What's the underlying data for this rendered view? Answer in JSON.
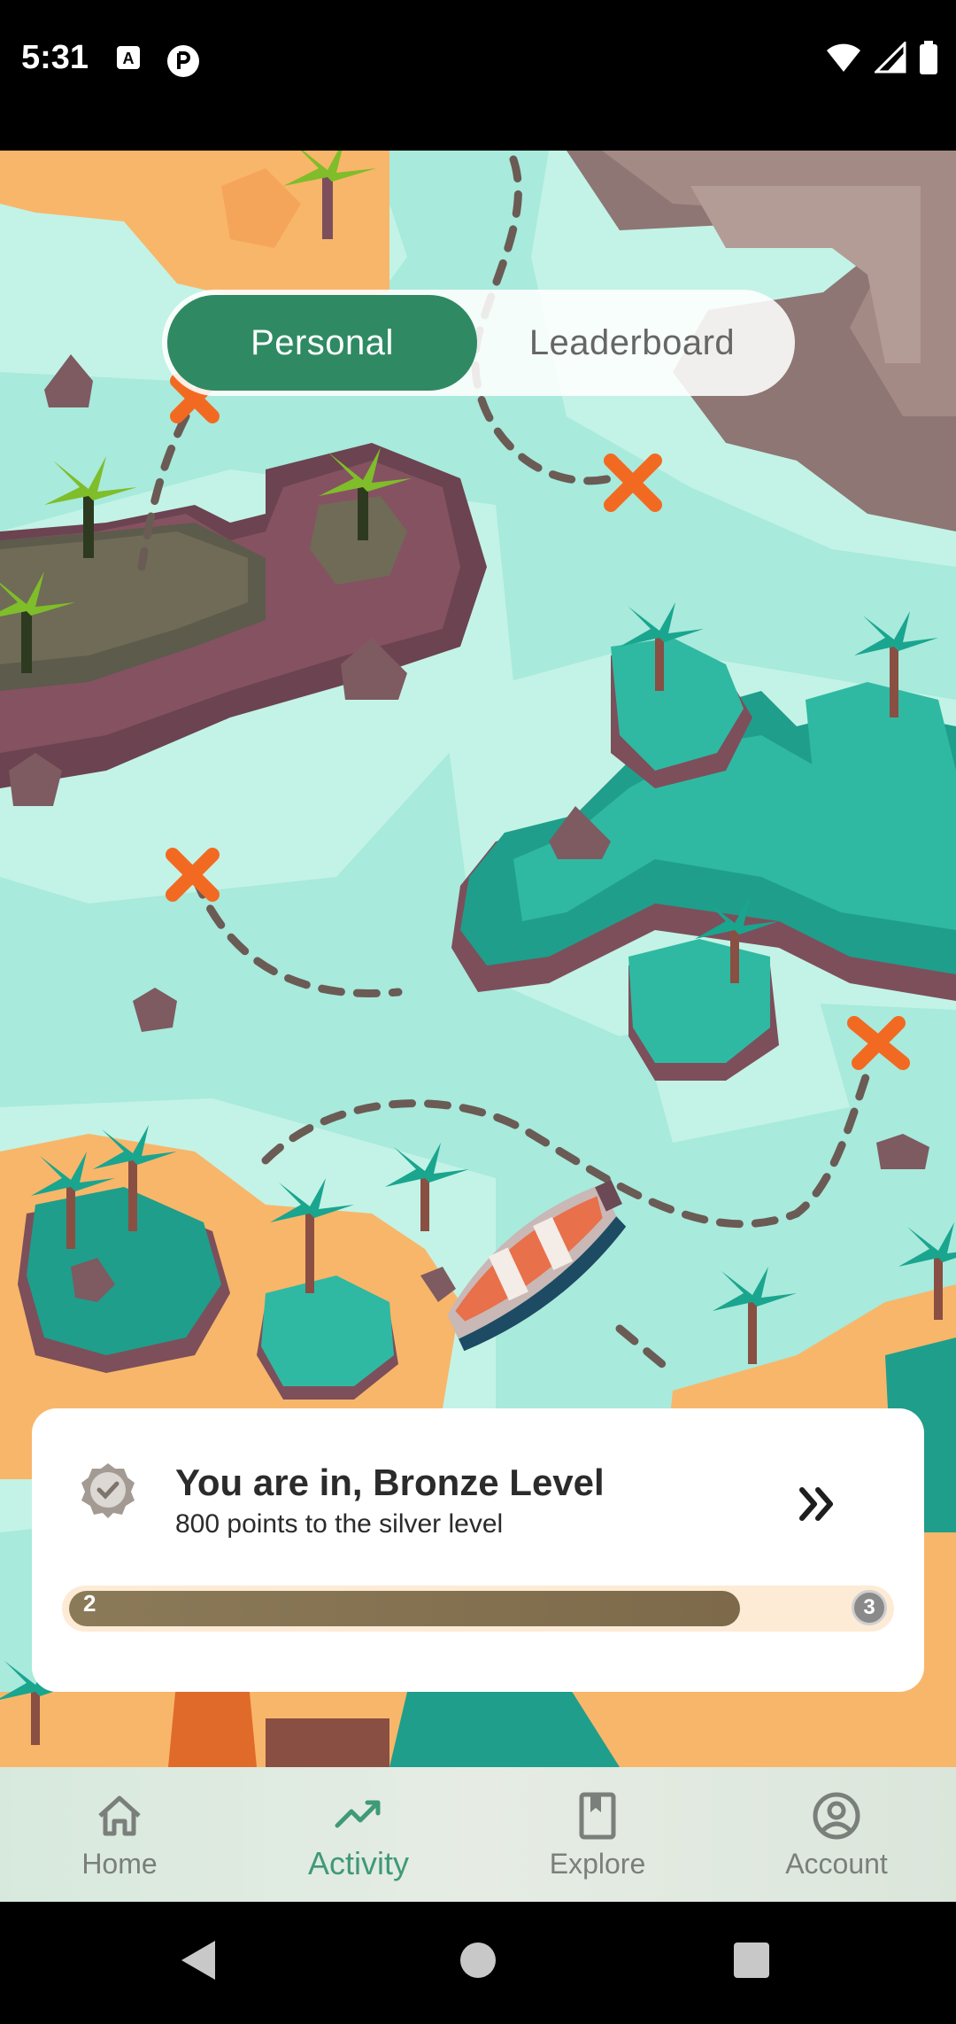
{
  "status_bar": {
    "time": "5:31",
    "icons_left": [
      "a-badge-icon",
      "vpn-icon"
    ],
    "icons_right": [
      "wifi-icon",
      "signal-icon",
      "battery-icon"
    ]
  },
  "toggle": {
    "personal_label": "Personal",
    "leaderboard_label": "Leaderboard",
    "active": "Personal"
  },
  "level_card": {
    "title": "You are in, Bronze Level",
    "subtitle": "800 points to the silver level",
    "progress_start": "2",
    "progress_end": "3",
    "progress_fraction": 0.82
  },
  "bottom_nav": {
    "items": [
      {
        "label": "Home",
        "icon": "home-icon"
      },
      {
        "label": "Activity",
        "icon": "trending-up-icon",
        "active": true
      },
      {
        "label": "Explore",
        "icon": "book-icon"
      },
      {
        "label": "Account",
        "icon": "account-icon"
      }
    ]
  },
  "colors": {
    "accent": "#2f8a63",
    "sea": "#a8eadc",
    "sand": "#f8b66a",
    "rock": "#7d5b61"
  }
}
